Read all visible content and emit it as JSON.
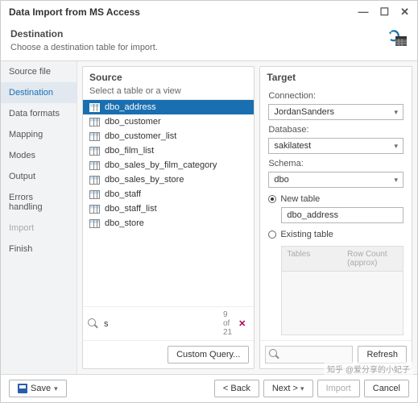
{
  "title": "Data Import from MS Access",
  "subheader": {
    "heading": "Destination",
    "desc": "Choose a destination table for import."
  },
  "sidebar": {
    "items": [
      {
        "label": "Source file",
        "state": "normal"
      },
      {
        "label": "Destination",
        "state": "active"
      },
      {
        "label": "Data formats",
        "state": "normal"
      },
      {
        "label": "Mapping",
        "state": "normal"
      },
      {
        "label": "Modes",
        "state": "normal"
      },
      {
        "label": "Output",
        "state": "normal"
      },
      {
        "label": "Errors handling",
        "state": "normal"
      },
      {
        "label": "Import",
        "state": "disabled"
      },
      {
        "label": "Finish",
        "state": "normal"
      }
    ]
  },
  "source": {
    "title": "Source",
    "subtitle": "Select a table or a view",
    "items": [
      "dbo_address",
      "dbo_customer",
      "dbo_customer_list",
      "dbo_film_list",
      "dbo_sales_by_film_category",
      "dbo_sales_by_store",
      "dbo_staff",
      "dbo_staff_list",
      "dbo_store"
    ],
    "selected_index": 0,
    "search_value": "s",
    "search_count": "9 of 21",
    "custom_query_label": "Custom Query..."
  },
  "target": {
    "title": "Target",
    "connection_label": "Connection:",
    "connection_value": "JordanSanders",
    "database_label": "Database:",
    "database_value": "sakilatest",
    "schema_label": "Schema:",
    "schema_value": "dbo",
    "new_table_label": "New table",
    "new_table_value": "dbo_address",
    "existing_table_label": "Existing table",
    "radio_selected": "new",
    "grid_cols": [
      "Tables",
      "Row Count (approx)"
    ],
    "refresh_label": "Refresh"
  },
  "footer": {
    "save_label": "Save",
    "back_label": "< Back",
    "next_label": "Next >",
    "import_label": "Import",
    "cancel_label": "Cancel"
  },
  "watermark": "知乎 @爱分享的小妃子"
}
